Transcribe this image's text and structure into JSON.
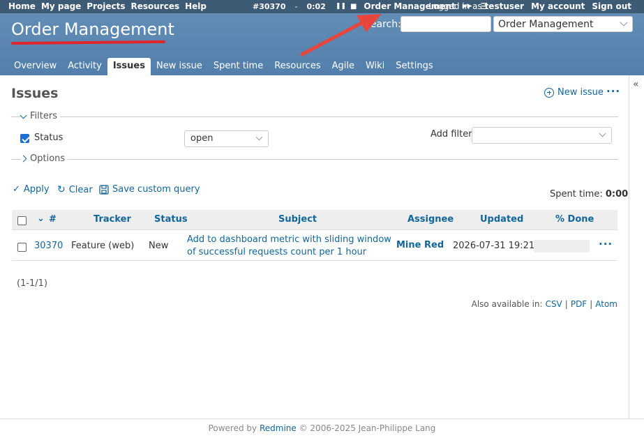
{
  "top_menu": {
    "items": [
      "Home",
      "My page",
      "Projects",
      "Resources",
      "Help"
    ],
    "timer": {
      "issue": "#30370",
      "separator": "-",
      "elapsed": "0:02",
      "project": "Order Management"
    },
    "logged_prefix": "Logged in as",
    "user": "testuser",
    "my_account": "My account",
    "sign_out": "Sign out"
  },
  "header": {
    "title": "Order Management",
    "search_label": "Search:",
    "search_value": "",
    "project_select": "Order Management"
  },
  "main_menu": {
    "tabs": [
      "Overview",
      "Activity",
      "Issues",
      "New issue",
      "Spent time",
      "Resources",
      "Agile",
      "Wiki",
      "Settings"
    ],
    "selected": "Issues"
  },
  "content": {
    "title": "Issues",
    "new_issue": "New issue",
    "filters_legend": "Filters",
    "status_label": "Status",
    "status_operator": "open",
    "add_filter_label": "Add filter",
    "add_filter_value": "",
    "options_legend": "Options",
    "apply": "Apply",
    "clear": "Clear",
    "save_query": "Save custom query",
    "spent_time_label": "Spent time:",
    "spent_time_value": "0:00"
  },
  "table": {
    "columns": [
      "#",
      "Tracker",
      "Status",
      "Subject",
      "Assignee",
      "Updated",
      "% Done"
    ],
    "rows": [
      {
        "id": "30370",
        "tracker": "Feature (web)",
        "status": "New",
        "subject_line1": "Add to dashboard metric with sliding window",
        "subject_line2": "of successful requests count per 1 hour",
        "assignee": "Mine Red",
        "updated": "2026-07-31 19:21",
        "done": 0
      }
    ]
  },
  "pagination": "(1-1/1)",
  "other_formats": {
    "label": "Also available in:",
    "csv": "CSV",
    "pdf": "PDF",
    "atom": "Atom",
    "sep": "|"
  },
  "footer": {
    "powered": "Powered by",
    "redmine": "Redmine",
    "copyright": "© 2006-2025 Jean-Philippe Lang"
  },
  "colors": {
    "header": "#628db6",
    "top_menu": "#3e5b76",
    "link": "#169",
    "arrow": "#e0252b"
  }
}
